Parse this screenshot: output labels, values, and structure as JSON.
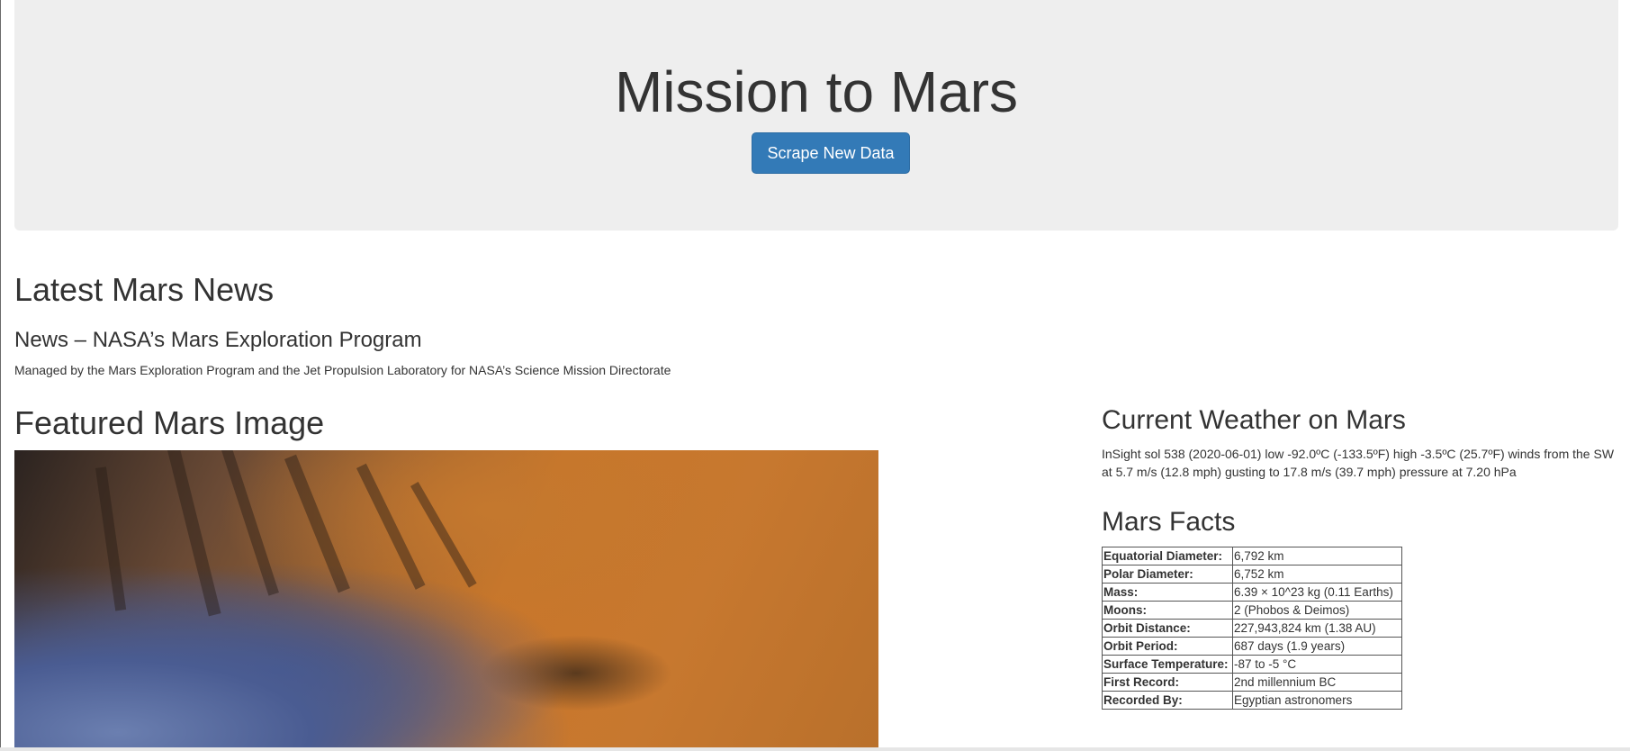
{
  "header": {
    "title": "Mission to Mars",
    "button_label": "Scrape New Data"
  },
  "news": {
    "heading": "Latest Mars News",
    "title": "News – NASA’s Mars Exploration Program",
    "paragraph": "Managed by the Mars Exploration Program and the Jet Propulsion Laboratory for NASA’s Science Mission Directorate"
  },
  "featured": {
    "heading": "Featured Mars Image"
  },
  "weather": {
    "heading": "Current Weather on Mars",
    "text": "InSight sol 538 (2020-06-01) low -92.0ºC (-133.5ºF) high -3.5ºC (25.7ºF) winds from the SW at 5.7 m/s (12.8 mph) gusting to 17.8 m/s (39.7 mph) pressure at 7.20 hPa"
  },
  "facts": {
    "heading": "Mars Facts",
    "rows": [
      {
        "label": "Equatorial Diameter:",
        "value": "6,792 km"
      },
      {
        "label": "Polar Diameter:",
        "value": "6,752 km"
      },
      {
        "label": "Mass:",
        "value": "6.39 × 10^23 kg (0.11 Earths)"
      },
      {
        "label": "Moons:",
        "value": "2 (Phobos & Deimos)"
      },
      {
        "label": "Orbit Distance:",
        "value": "227,943,824 km (1.38 AU)"
      },
      {
        "label": "Orbit Period:",
        "value": "687 days (1.9 years)"
      },
      {
        "label": "Surface Temperature:",
        "value": "-87 to -5 °C"
      },
      {
        "label": "First Record:",
        "value": "2nd millennium BC"
      },
      {
        "label": "Recorded By:",
        "value": "Egyptian astronomers"
      }
    ]
  },
  "colors": {
    "jumbotron_bg": "#eeeeee",
    "button_bg": "#337ab7",
    "text": "#333333"
  }
}
